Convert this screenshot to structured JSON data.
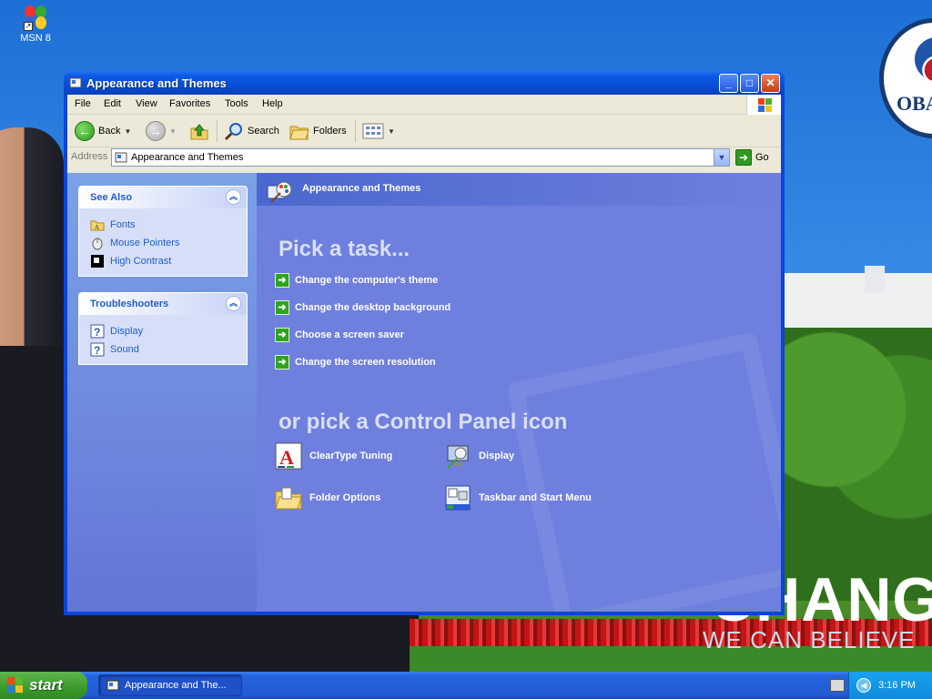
{
  "desktop": {
    "icon_label": "MSN 8",
    "wallpaper_change": "CHANGE",
    "wallpaper_believe": "WE CAN BELIEVE",
    "wallpaper_logo": "OBAMA"
  },
  "window": {
    "title": "Appearance and Themes",
    "menu": [
      "File",
      "Edit",
      "View",
      "Favorites",
      "Tools",
      "Help"
    ],
    "toolbar": {
      "back": "Back",
      "search": "Search",
      "folders": "Folders"
    },
    "address": {
      "label": "Address",
      "value": "Appearance and Themes",
      "go": "Go"
    }
  },
  "left_pane": {
    "see_also": {
      "title": "See Also",
      "items": [
        {
          "label": "Fonts",
          "icon": "fonts-folder-icon"
        },
        {
          "label": "Mouse Pointers",
          "icon": "mouse-icon"
        },
        {
          "label": "High Contrast",
          "icon": "high-contrast-icon"
        }
      ]
    },
    "troubleshooters": {
      "title": "Troubleshooters",
      "items": [
        {
          "label": "Display",
          "icon": "help-icon"
        },
        {
          "label": "Sound",
          "icon": "help-icon"
        }
      ]
    }
  },
  "main_pane": {
    "header": "Appearance and Themes",
    "pick_task": "Pick a task...",
    "tasks": [
      "Change the computer's theme",
      "Change the desktop background",
      "Choose a screen saver",
      "Change the screen resolution"
    ],
    "pick_icon": "or pick a Control Panel icon",
    "icons": [
      {
        "label": "ClearType Tuning",
        "icon": "cleartype-icon"
      },
      {
        "label": "Display",
        "icon": "display-icon"
      },
      {
        "label": "Folder Options",
        "icon": "folder-options-icon"
      },
      {
        "label": "Taskbar and Start Menu",
        "icon": "taskbar-icon"
      }
    ]
  },
  "taskbar": {
    "start": "start",
    "task_button": "Appearance and The...",
    "clock": "3:16 PM"
  },
  "colors": {
    "xp_blue": "#0a45d8",
    "pane_blue": "#6f7fde",
    "link_blue": "#215dc6",
    "start_green": "#3c9a2b"
  }
}
